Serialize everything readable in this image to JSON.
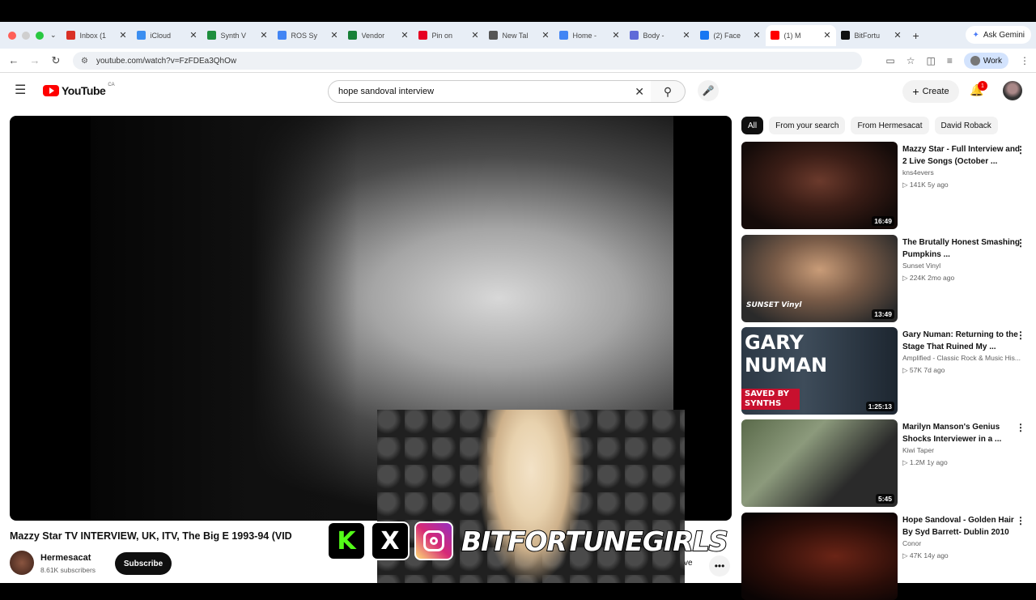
{
  "browser": {
    "tabs": [
      {
        "label": "Inbox (1",
        "color": "#d93025"
      },
      {
        "label": "iCloud",
        "color": "#3b8ef0"
      },
      {
        "label": "Synth V",
        "color": "#1e8e3e"
      },
      {
        "label": "ROS Sy",
        "color": "#4285f4"
      },
      {
        "label": "Vendor",
        "color": "#188038"
      },
      {
        "label": "Pin on",
        "color": "#e60023"
      },
      {
        "label": "New Tal",
        "color": "#555555"
      },
      {
        "label": "Home -",
        "color": "#4285f4"
      },
      {
        "label": "Body -",
        "color": "#5f6ad8"
      },
      {
        "label": "(2) Face",
        "color": "#1877f2"
      },
      {
        "label": "(1) M",
        "color": "#ff0000"
      },
      {
        "label": "BitFortu",
        "color": "#111111"
      }
    ],
    "active_tab_index": 10,
    "new_tab": "+",
    "gemini_label": "Ask Gemini",
    "url": "youtube.com/watch?v=FzFDEa3QhOw",
    "profile_label": "Work"
  },
  "youtube": {
    "logo_text": "YouTube",
    "country_code": "CA",
    "search_query": "hope sandoval interview",
    "create_label": "Create",
    "notification_count": "1",
    "video_title": "Mazzy Star TV INTERVIEW, UK, ITV, The Big E 1993-94 (VID",
    "channel_name": "Hermesacat",
    "channel_subs": "8.61K subscribers",
    "subscribe_label": "Subscribe",
    "save_fragment": "ve",
    "chips": [
      "All",
      "From your search",
      "From Hermesacat",
      "David Roback"
    ],
    "recommendations": [
      {
        "title": "Mazzy Star - Full Interview and 2 Live Songs (October ...",
        "channel": "kns4evers",
        "views": "141K",
        "age": "5y ago",
        "duration": "16:49"
      },
      {
        "title": "The Brutally Honest Smashing Pumpkins ...",
        "channel": "Sunset Vinyl",
        "views": "224K",
        "age": "2mo ago",
        "duration": "13:49",
        "thumb_text": "SUNSET Vinyl"
      },
      {
        "title": "Gary Numan: Returning to the Stage That Ruined My ...",
        "channel": "Amplified - Classic Rock & Music His...",
        "views": "57K",
        "age": "7d ago",
        "duration": "1:25:13",
        "thumb_text_1": "GARY",
        "thumb_text_2": "NUMAN",
        "thumb_text_3": "SAVED BY SYNTHS"
      },
      {
        "title": "Marilyn Manson's Genius Shocks Interviewer in a ...",
        "channel": "Kiwi Taper",
        "views": "1.2M",
        "age": "1y ago",
        "duration": "5:45"
      },
      {
        "title": "Hope Sandoval - Golden Hair By Syd Barrett- Dublin 2010",
        "channel": "Conor",
        "views": "47K",
        "age": "14y ago",
        "duration": ""
      }
    ]
  },
  "overlay": {
    "brand_text": "BITFORTUNEGIRLS",
    "kick_glyph": "K",
    "x_glyph": "X",
    "kick_color": "#53fc18",
    "instagram_icon": "instagram-icon"
  }
}
